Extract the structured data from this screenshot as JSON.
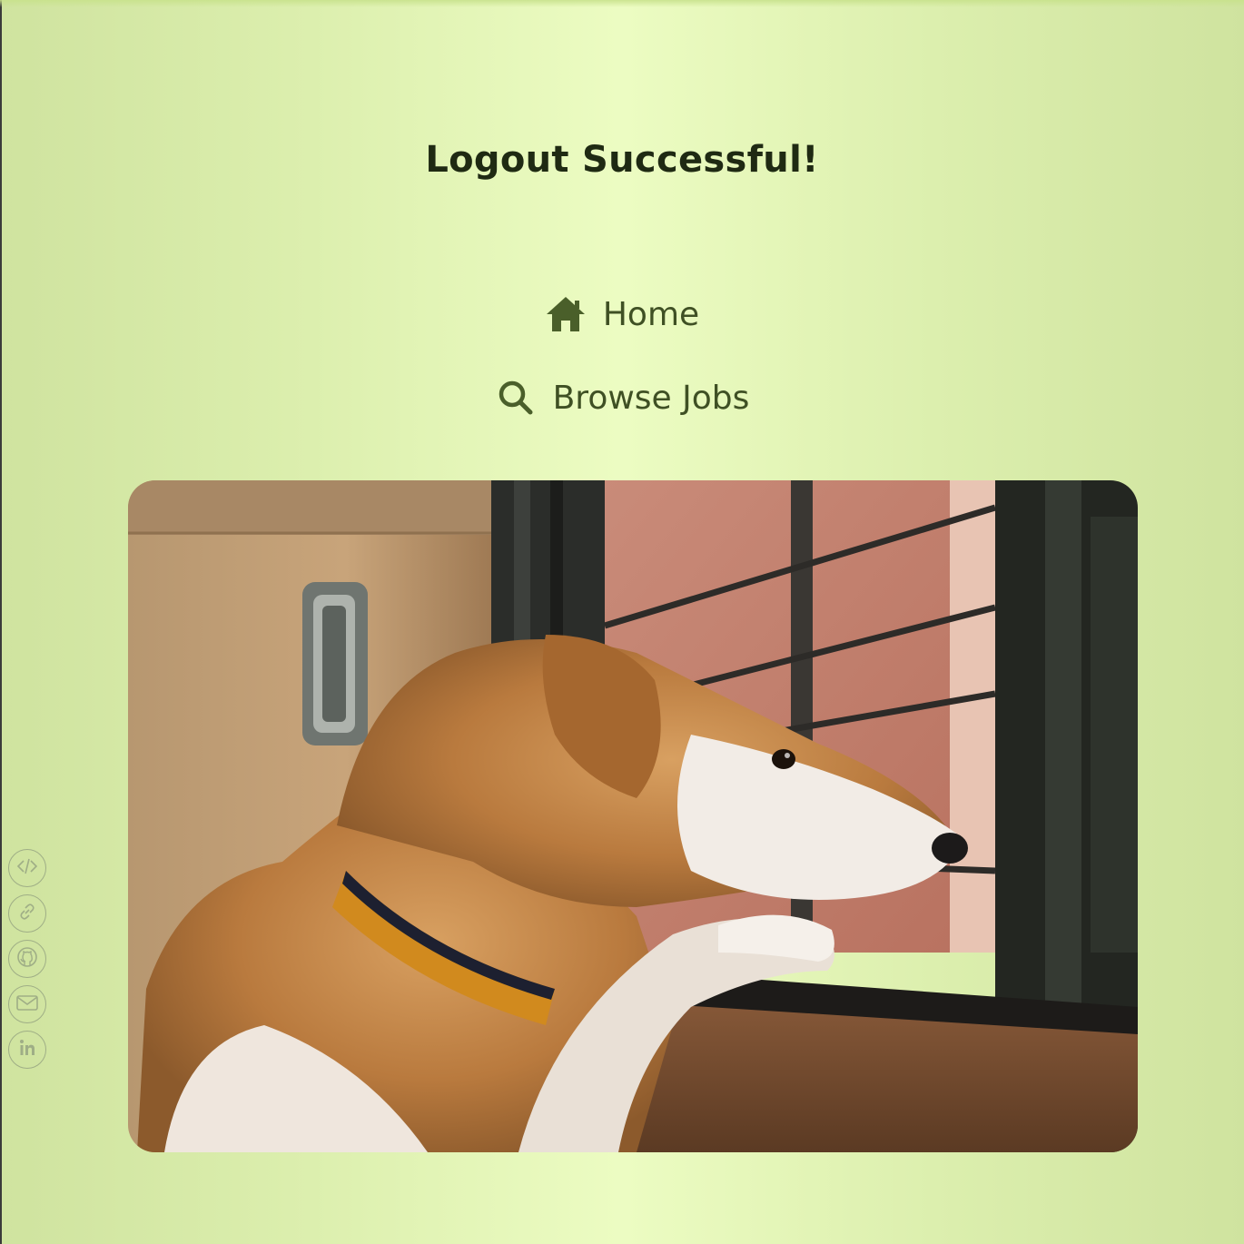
{
  "page": {
    "title": "Logout Successful!"
  },
  "nav": {
    "items": [
      {
        "label": "Home",
        "icon": "home-icon"
      },
      {
        "label": "Browse Jobs",
        "icon": "search-icon"
      }
    ]
  },
  "photo": {
    "subject": "dog looking out window"
  },
  "socials": [
    {
      "icon": "code-icon"
    },
    {
      "icon": "link-icon"
    },
    {
      "icon": "github-icon"
    },
    {
      "icon": "mail-icon"
    },
    {
      "icon": "linkedin-icon"
    }
  ],
  "colors": {
    "background_center": "#ecfcc2",
    "background_edge": "#cfe39f",
    "title": "#1f2a13",
    "link": "#3f5024",
    "icon": "#4a5f2a",
    "social_icon": "#9fae86"
  }
}
